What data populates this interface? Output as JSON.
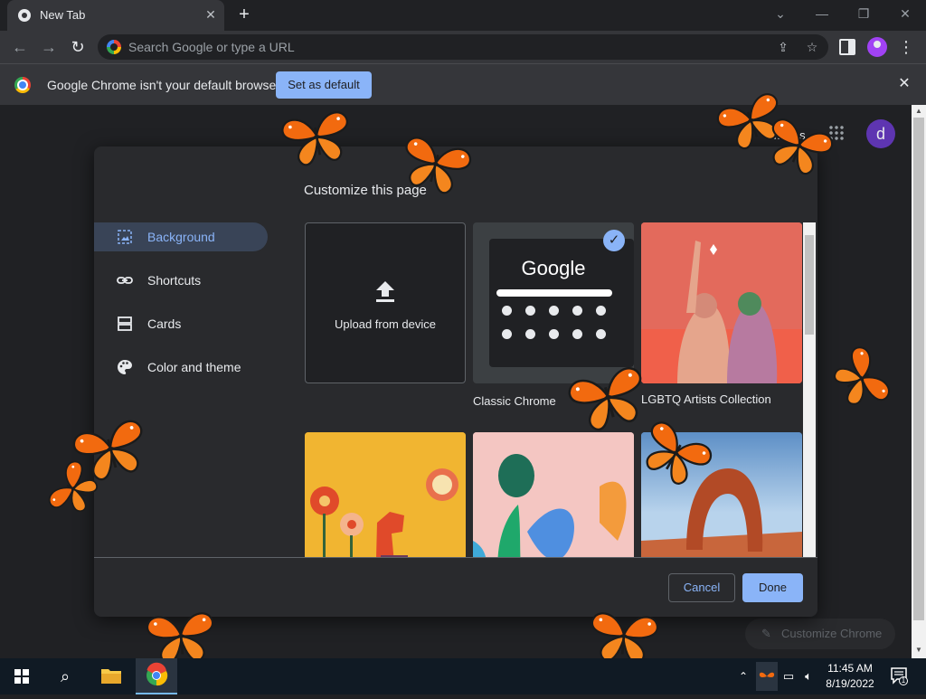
{
  "browser": {
    "tab_title": "New Tab",
    "omnibox_placeholder": "Search Google or type a URL"
  },
  "infobar": {
    "message": "Google Chrome isn't your default browser",
    "set_default_label": "Set as default"
  },
  "ntp": {
    "images_link": "Images",
    "avatar_letter": "d",
    "customize_chrome_label": "Customize Chrome"
  },
  "dialog": {
    "title": "Customize this page",
    "nav": [
      {
        "label": "Background",
        "icon": "image-icon",
        "active": true
      },
      {
        "label": "Shortcuts",
        "icon": "link-icon",
        "active": false
      },
      {
        "label": "Cards",
        "icon": "cards-icon",
        "active": false
      },
      {
        "label": "Color and theme",
        "icon": "palette-icon",
        "active": false
      }
    ],
    "tiles": {
      "upload_label": "Upload from device",
      "classic_google_text": "Google",
      "classic_label": "Classic Chrome",
      "artist_label": "LGBTQ Artists Collection"
    },
    "cancel_label": "Cancel",
    "done_label": "Done"
  },
  "taskbar": {
    "time": "11:45 AM",
    "date": "8/19/2022",
    "notification_count": "1"
  },
  "colors": {
    "accent": "#8ab4f8",
    "background": "#202124",
    "dialog": "#292a2d",
    "butterfly": "#f26a0f"
  }
}
